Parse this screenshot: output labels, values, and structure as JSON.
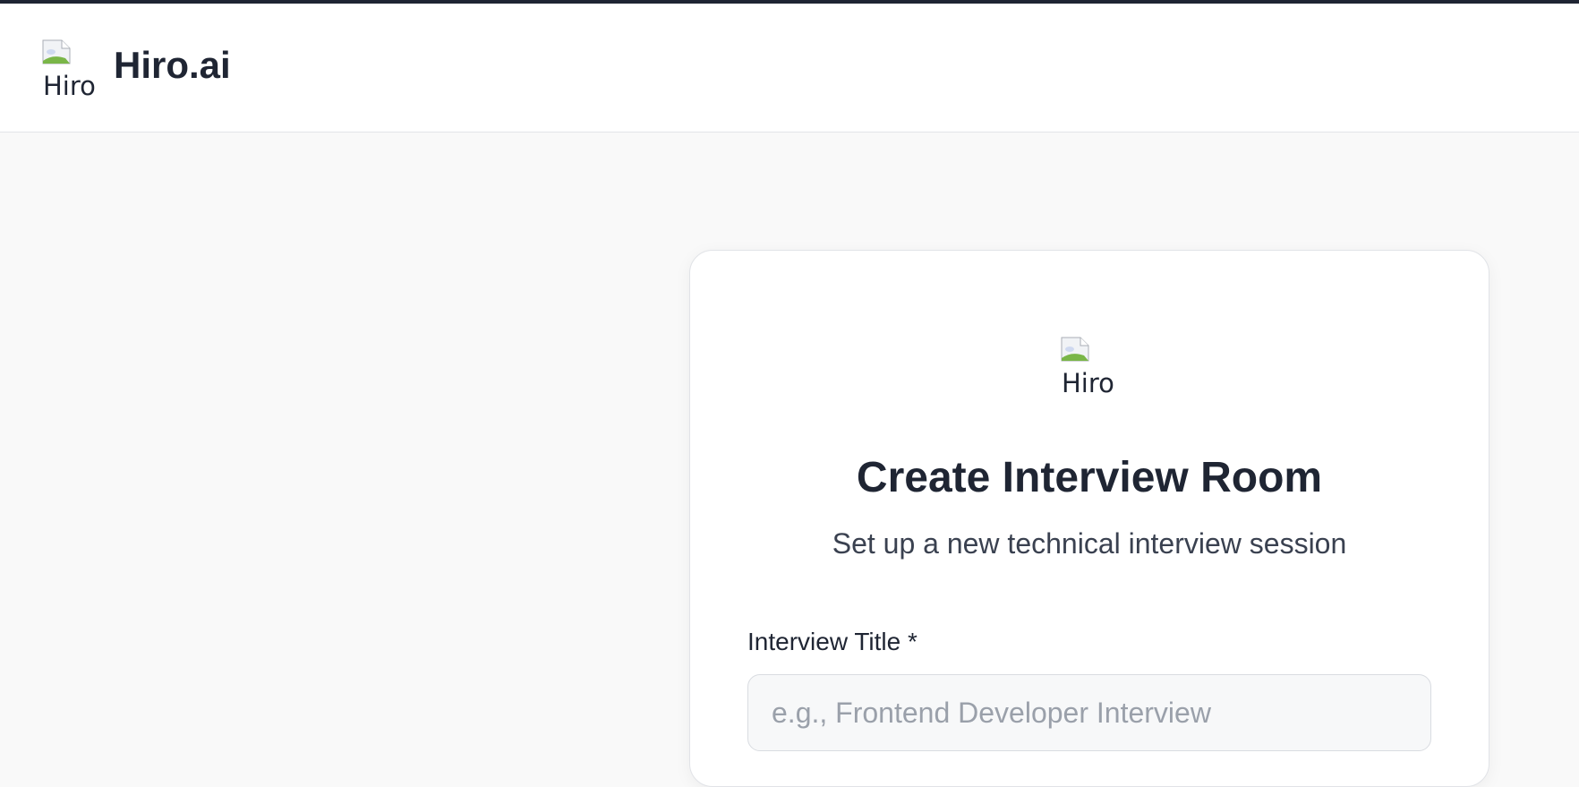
{
  "header": {
    "logo_alt": "Hiro",
    "brand_name": "Hiro.ai"
  },
  "card": {
    "logo_alt": "Hiro",
    "title": "Create Interview Room",
    "subtitle": "Set up a new technical interview session",
    "fields": {
      "interview_title": {
        "label": "Interview Title *",
        "placeholder": "e.g., Frontend Developer Interview",
        "value": ""
      }
    }
  },
  "colors": {
    "top_strip": "#1f2533",
    "header_bg": "#ffffff",
    "page_bg": "#f9f9f9",
    "text_primary": "#1f2533",
    "text_secondary": "#3a4150",
    "placeholder": "#9aa0aa"
  },
  "icons": {
    "broken_image": "broken-image-icon"
  }
}
